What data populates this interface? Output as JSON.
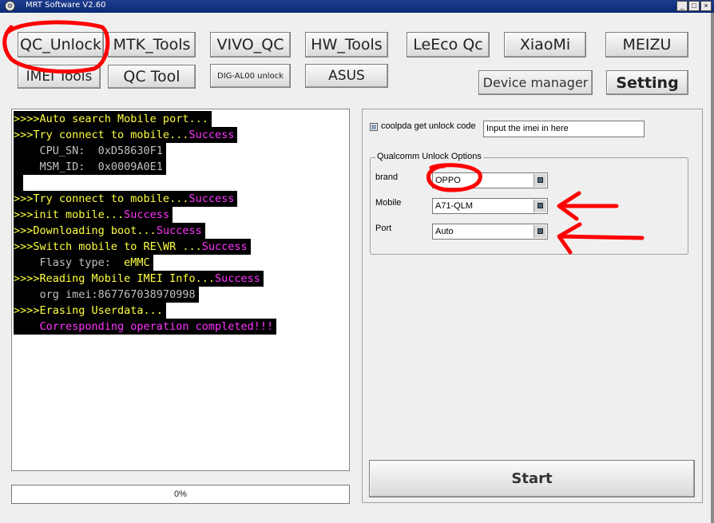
{
  "window": {
    "title": "MRT Software V2.60",
    "controls": [
      "_",
      "□",
      "×"
    ]
  },
  "toolbar": {
    "row1": [
      "QC_Unlock",
      "MTK_Tools",
      "VIVO_QC",
      "HW_Tools",
      "LeEco Qc",
      "XiaoMi",
      "MEIZU"
    ],
    "row2": [
      "IMEI Tools",
      "QC Tool",
      "DIG-AL00 unlock",
      "ASUS"
    ],
    "device_manager": "Device manager",
    "setting": "Setting"
  },
  "log": {
    "lines": [
      {
        "segments": [
          {
            "text": ">>>>Auto search Mobile port...",
            "color": "yellow"
          }
        ]
      },
      {
        "segments": [
          {
            "text": ">>>Try connect to mobile...",
            "color": "yellow"
          },
          {
            "text": "Success",
            "color": "magenta"
          }
        ]
      },
      {
        "segments": [
          {
            "text": "    CPU_SN:  0xD58630F1",
            "color": "gray"
          }
        ]
      },
      {
        "segments": [
          {
            "text": "    MSM_ID:  0x0009A0E1",
            "color": "gray"
          }
        ]
      },
      {
        "segments": [
          {
            "text": " ",
            "color": "gray"
          }
        ]
      },
      {
        "segments": [
          {
            "text": ">>>Try connect to mobile...",
            "color": "yellow"
          },
          {
            "text": "Success",
            "color": "magenta"
          }
        ]
      },
      {
        "segments": [
          {
            "text": ">>>init mobile...",
            "color": "yellow"
          },
          {
            "text": "Success",
            "color": "magenta"
          }
        ]
      },
      {
        "segments": [
          {
            "text": ">>>Downloading boot...",
            "color": "yellow"
          },
          {
            "text": "Success",
            "color": "magenta"
          }
        ]
      },
      {
        "segments": [
          {
            "text": ">>>Switch mobile to RE\\WR ...",
            "color": "yellow"
          },
          {
            "text": "Success",
            "color": "magenta"
          }
        ]
      },
      {
        "segments": [
          {
            "text": "    Flasy type:  ",
            "color": "gray"
          },
          {
            "text": "eMMC",
            "color": "yellow"
          }
        ]
      },
      {
        "segments": [
          {
            "text": ">>>>Reading Mobile IMEI Info...",
            "color": "yellow"
          },
          {
            "text": "Success",
            "color": "magenta"
          }
        ]
      },
      {
        "segments": [
          {
            "text": "    org imei:867767038970998",
            "color": "gray"
          }
        ]
      },
      {
        "segments": [
          {
            "text": ">>>>Erasing Userdata...",
            "color": "yellow"
          }
        ]
      },
      {
        "segments": [
          {
            "text": "    Corresponding operation completed!!!",
            "color": "magenta"
          }
        ]
      }
    ]
  },
  "progress": {
    "label": "0%",
    "value": 0
  },
  "unlock_panel": {
    "checkbox_label": "coolpda get unlock code",
    "imei_input": {
      "value": "Input the imei in here"
    },
    "group_title": "Qualcomm Unlock Options",
    "brand": {
      "label": "brand",
      "value": "OPPO"
    },
    "mobile": {
      "label": "Mobile",
      "value": "A71-QLM"
    },
    "port": {
      "label": "Port",
      "value": "Auto"
    },
    "start": "Start"
  },
  "colors": {
    "log_yellow": "#ffff40",
    "log_magenta": "#ff33ff",
    "log_gray": "#c0c0c0",
    "annotation_red": "#ff0000",
    "titlebar": "#0b2a75"
  }
}
